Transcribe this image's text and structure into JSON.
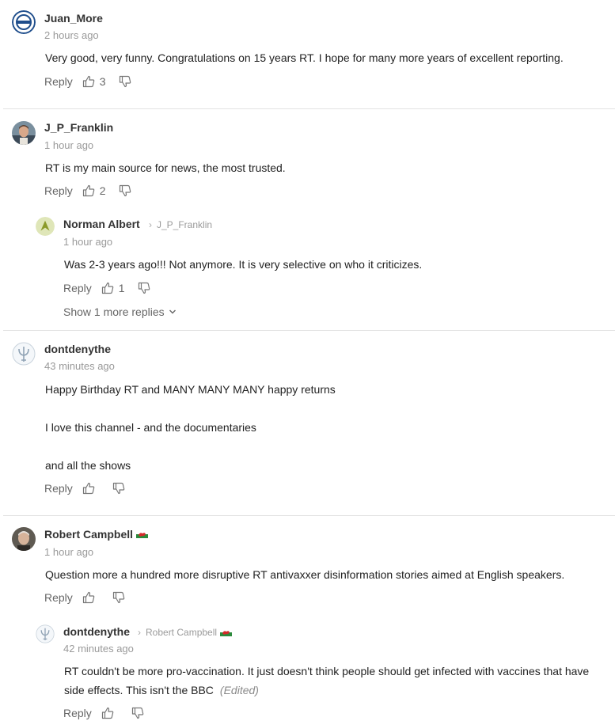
{
  "comments": [
    {
      "author": "Juan_More",
      "time": "2 hours ago",
      "text": "Very good, very funny. Congratulations on 15 years RT.  I hope for many more years of excellent reporting.",
      "reply_label": "Reply",
      "likes": "3"
    },
    {
      "author": "J_P_Franklin",
      "time": "1 hour ago",
      "text": "RT is my main source for news, the most trusted.",
      "reply_label": "Reply",
      "likes": "2",
      "replies": [
        {
          "author": "Norman Albert",
          "reply_to": "J_P_Franklin",
          "time": "1 hour ago",
          "text": "Was 2-3 years ago!!! Not anymore. It is very selective on who it criticizes.",
          "reply_label": "Reply",
          "likes": "1"
        }
      ],
      "show_more_label": "Show 1 more replies"
    },
    {
      "author": "dontdenythe",
      "time": "43 minutes ago",
      "text_lines": [
        "Happy Birthday RT and MANY MANY MANY happy returns",
        "I love this channel - and the documentaries",
        "and all the shows"
      ],
      "reply_label": "Reply",
      "likes": ""
    },
    {
      "author": "Robert Campbell",
      "time": "1 hour ago",
      "text": "Question more a hundred more disruptive RT antivaxxer disinformation stories aimed at English speakers.",
      "reply_label": "Reply",
      "likes": "",
      "replies": [
        {
          "author": "dontdenythe",
          "reply_to": "Robert Campbell",
          "time": "42 minutes ago",
          "text_lines": [
            "RT couldn't be more pro-vaccination.  It just doesn't think people should get infected with vaccines that have",
            "side effects.  This isn't the BBC"
          ],
          "edited_label": "(Edited)",
          "reply_label": "Reply",
          "likes": ""
        }
      ]
    }
  ],
  "colors": {
    "text": "#222222",
    "muted": "#9a9a9a",
    "divider": "#e2e2e2"
  }
}
